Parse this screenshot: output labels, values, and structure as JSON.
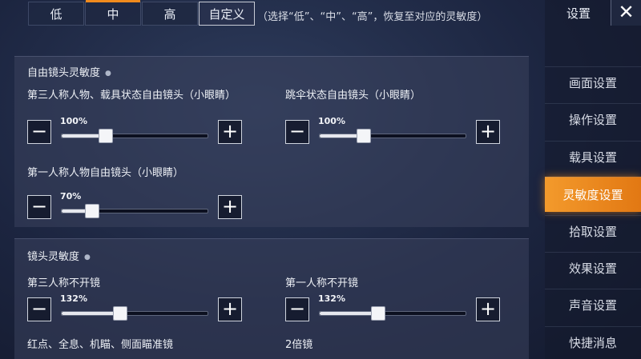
{
  "presets": {
    "low": "低",
    "medium": "中",
    "high": "高",
    "custom": "自定义",
    "hint": "（选择“低”、“中”、“高”，恢复至对应的灵敏度）"
  },
  "free_look": {
    "title": "自由镜头灵敏度",
    "third_person": {
      "label": "第三人称人物、载具状态自由镜头（小眼睛）",
      "value_text": "100%",
      "level": 0.3
    },
    "parachute": {
      "label": "跳伞状态自由镜头（小眼睛）",
      "value_text": "100%",
      "level": 0.3
    },
    "first_person": {
      "label": "第一人称人物自由镜头（小眼睛）",
      "value_text": "70%",
      "level": 0.21
    }
  },
  "camera": {
    "title": "镜头灵敏度",
    "third_person_noscope": {
      "label": "第三人称不开镜",
      "value_text": "132%",
      "level": 0.4
    },
    "first_person_noscope": {
      "label": "第一人称不开镜",
      "value_text": "132%",
      "level": 0.4
    },
    "reddot_label": "红点、全息、机瞄、侧面瞄准镜",
    "scope2x_label": "2倍镜"
  },
  "controls": {
    "minus": "−",
    "plus": "+"
  },
  "menu": {
    "title": "设置",
    "close": "✕",
    "items": [
      "画面设置",
      "操作设置",
      "载具设置",
      "灵敏度设置",
      "拾取设置",
      "效果设置",
      "声音设置",
      "快捷消息"
    ]
  },
  "colors": {
    "accent": "#f08a1d"
  }
}
